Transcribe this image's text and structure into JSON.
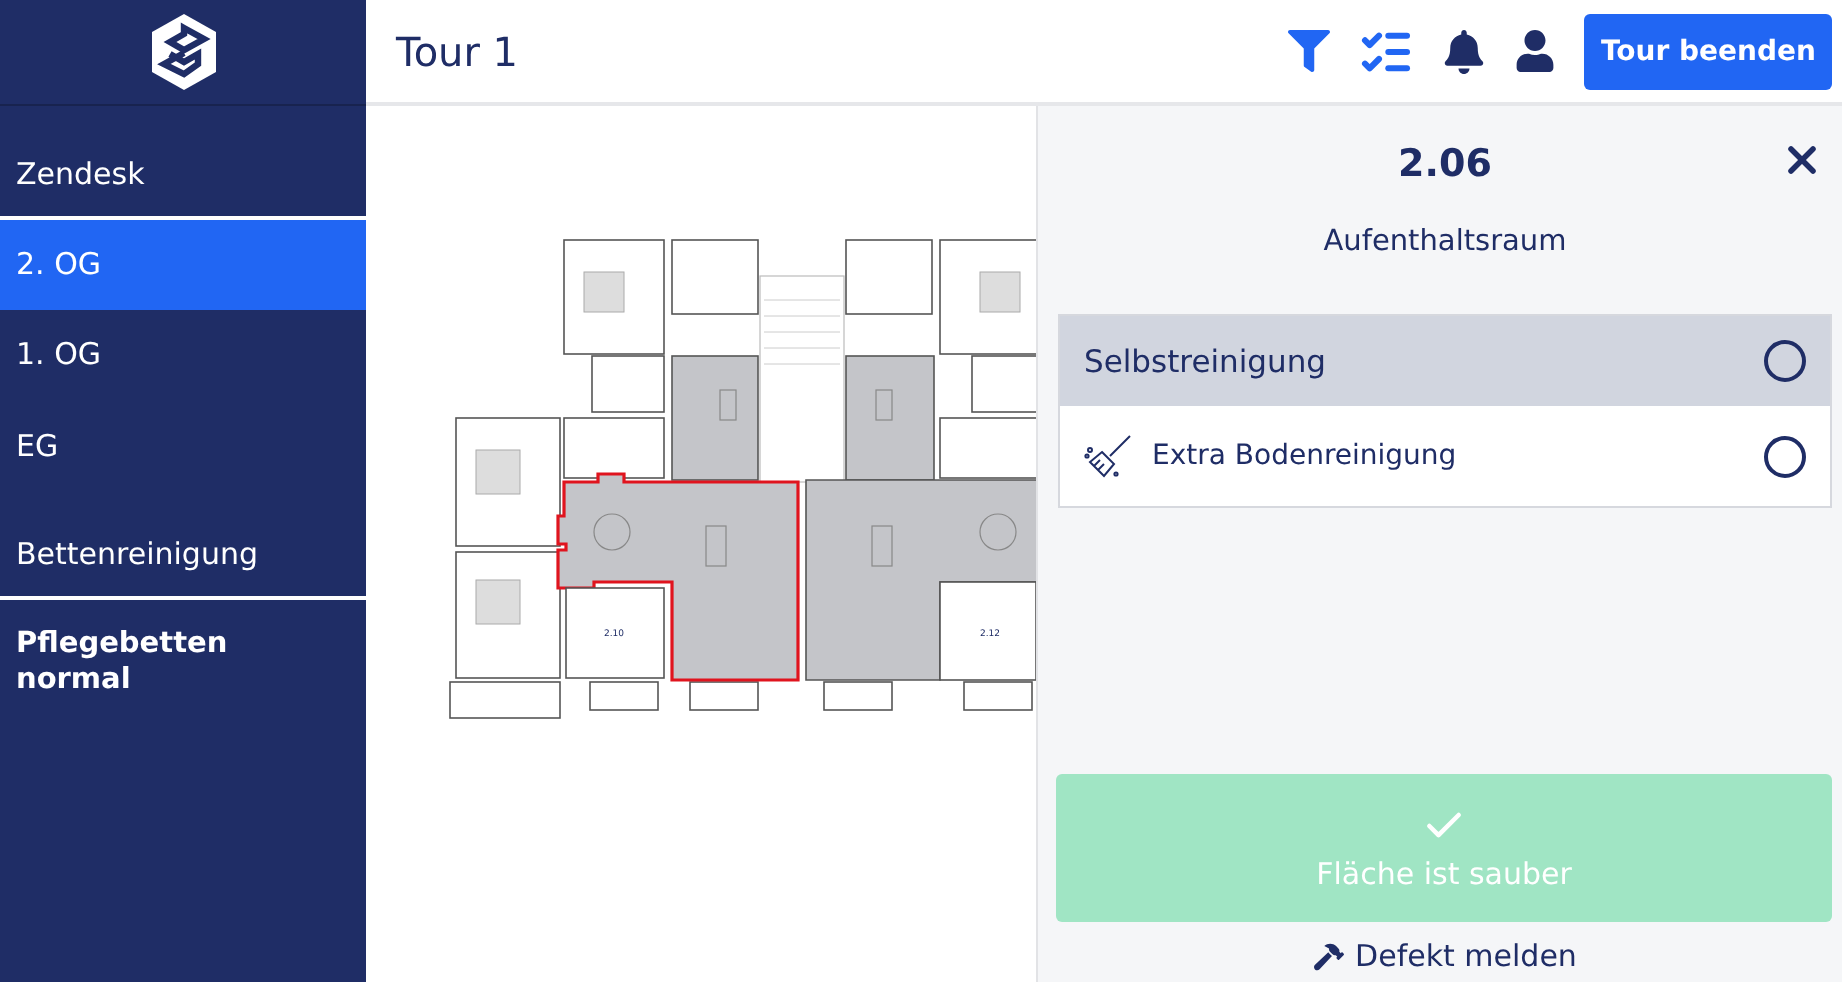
{
  "header": {
    "title": "Tour 1",
    "end_button": "Tour beenden"
  },
  "sidebar": {
    "items": [
      {
        "kind": "section",
        "label": "Zendesk",
        "selected": false
      },
      {
        "kind": "item",
        "label": "2. OG",
        "selected": true
      },
      {
        "kind": "item",
        "label": "1. OG",
        "selected": false
      },
      {
        "kind": "item",
        "label": "EG",
        "selected": false
      },
      {
        "kind": "section",
        "label": "Bettenreinigung",
        "selected": false
      },
      {
        "kind": "entry",
        "label": "Pflegebetten normal",
        "selected": false
      }
    ]
  },
  "floor_plan": {
    "room_labels": [
      "2.10",
      "2.12"
    ]
  },
  "detail": {
    "room_number": "2.06",
    "room_name": "Aufenthaltsraum",
    "tasks": [
      {
        "kind": "group",
        "label": "Selbstreinigung",
        "checked": false
      },
      {
        "kind": "task",
        "label": "Extra Bodenreinigung",
        "checked": false
      }
    ],
    "clean_button": {
      "label": "Fläche ist sauber",
      "disabled": true
    },
    "report_link": "Defekt melden"
  }
}
